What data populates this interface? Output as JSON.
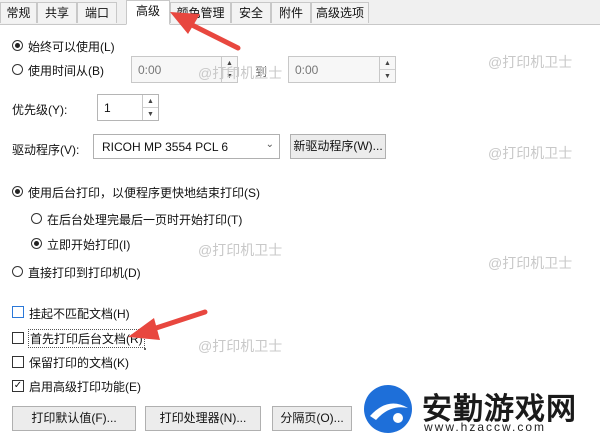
{
  "tabs": [
    {
      "label": "常规"
    },
    {
      "label": "共享"
    },
    {
      "label": "端口"
    },
    {
      "label": "高级"
    },
    {
      "label": "颜色管理"
    },
    {
      "label": "安全"
    },
    {
      "label": "附件"
    },
    {
      "label": "高级选项"
    }
  ],
  "active_tab": "高级",
  "availability": {
    "always_label": "始终可以使用(L)",
    "time_label": "使用时间从(B)",
    "from_time": "0:00",
    "to_label": "到",
    "to_time": "0:00"
  },
  "priority": {
    "label": "优先级(Y):",
    "value": "1"
  },
  "driver": {
    "label": "驱动程序(V):",
    "value": "RICOH MP 3554 PCL 6",
    "new_driver_button": "新驱动程序(W)..."
  },
  "spool": {
    "spool_label": "使用后台打印，以便程序更快地结束打印(S)",
    "after_last_page_label": "在后台处理完最后一页时开始打印(T)",
    "immediately_label": "立即开始打印(I)",
    "direct_label": "直接打印到打印机(D)"
  },
  "options": {
    "hold_mismatched": "挂起不匹配文档(H)",
    "print_spooled_first": "首先打印后台文档(R)",
    "keep_printed": "保留打印的文档(K)",
    "enable_advanced": "启用高级打印功能(E)"
  },
  "buttons": {
    "defaults": "打印默认值(F)...",
    "processor": "打印处理器(N)...",
    "separator": "分隔页(O)..."
  },
  "watermark": {
    "text": "@打印机卫士",
    "brand_name": "安勤游戏网",
    "brand_url": "www.hzaccw.com"
  },
  "colors": {
    "annotation_arrow": "#e8473f",
    "brand_blue": "#1e6fd9"
  }
}
